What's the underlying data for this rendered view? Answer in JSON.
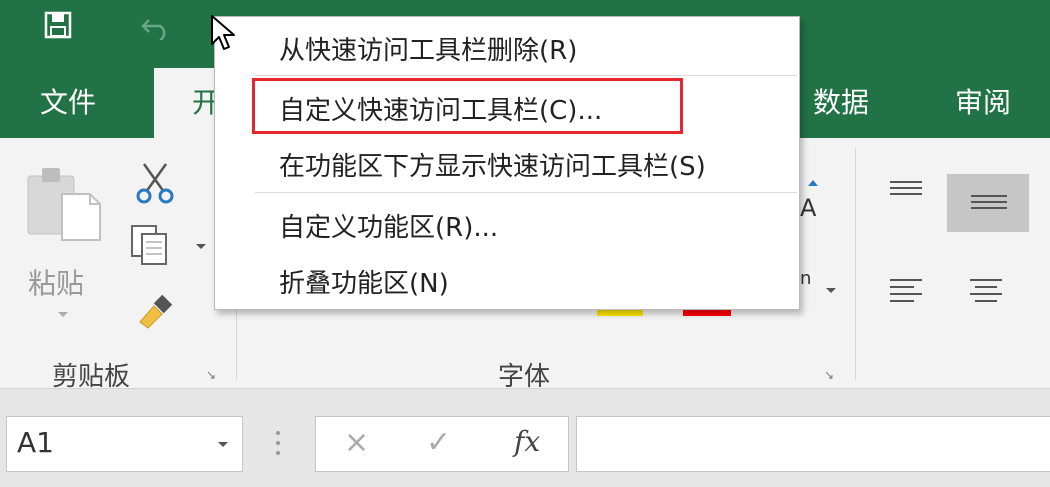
{
  "titlebar": {
    "save_icon": "save-icon",
    "undo_icon": "undo-icon"
  },
  "tabs": {
    "file": "文件",
    "home": "开",
    "data": "数据",
    "review": "审阅"
  },
  "ribbon": {
    "paste_label": "粘贴",
    "clipboard_group": "剪贴板",
    "font_group": "字体",
    "partial_glyph_a": "A",
    "partial_glyph_n": "n"
  },
  "formula_bar": {
    "name_box_value": "A1",
    "cancel_glyph": "×",
    "enter_glyph": "✓",
    "fx_label": "fx",
    "formula_value": ""
  },
  "context_menu": {
    "items": [
      "从快速访问工具栏删除(R)",
      "自定义快速访问工具栏(C)...",
      "在功能区下方显示快速访问工具栏(S)",
      "自定义功能区(R)...",
      "折叠功能区(N)"
    ]
  },
  "colors": {
    "excel_green": "#217346",
    "highlight_red": "#e8262d",
    "font_color_bar": "#ff0000",
    "highlight_color_bar": "#ffe600"
  }
}
